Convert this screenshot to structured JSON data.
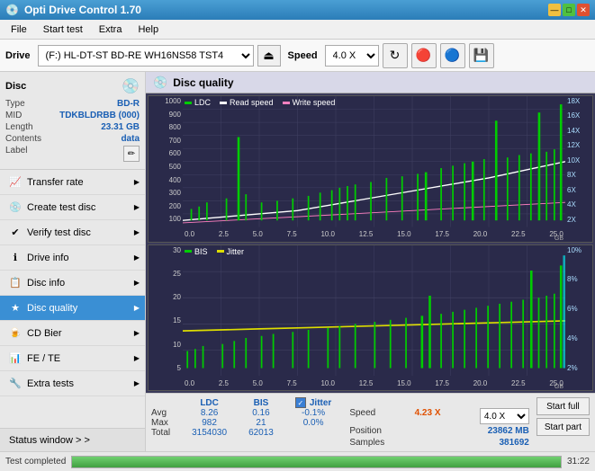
{
  "titlebar": {
    "title": "Opti Drive Control 1.70",
    "icon": "💿",
    "min_btn": "—",
    "max_btn": "□",
    "close_btn": "✕"
  },
  "menubar": {
    "items": [
      {
        "label": "File"
      },
      {
        "label": "Start test"
      },
      {
        "label": "Extra"
      },
      {
        "label": "Help"
      }
    ]
  },
  "toolbar": {
    "drive_label": "Drive",
    "drive_value": "(F:)  HL-DT-ST BD-RE  WH16NS58 TST4",
    "speed_label": "Speed",
    "speed_value": "4.0 X",
    "eject_icon": "⏏",
    "refresh_icon": "↻",
    "icon1": "🔴",
    "icon2": "🔵",
    "save_icon": "💾"
  },
  "disc": {
    "section_label": "Disc",
    "type_label": "Type",
    "type_value": "BD-R",
    "mid_label": "MID",
    "mid_value": "TDKBLDRBB (000)",
    "length_label": "Length",
    "length_value": "23.31 GB",
    "contents_label": "Contents",
    "contents_value": "data",
    "label_label": "Label",
    "label_btn_icon": "✏"
  },
  "sidebar_nav": [
    {
      "id": "transfer-rate",
      "label": "Transfer rate",
      "icon": "📈"
    },
    {
      "id": "create-test-disc",
      "label": "Create test disc",
      "icon": "💿"
    },
    {
      "id": "verify-test-disc",
      "label": "Verify test disc",
      "icon": "✔"
    },
    {
      "id": "drive-info",
      "label": "Drive info",
      "icon": "ℹ"
    },
    {
      "id": "disc-info",
      "label": "Disc info",
      "icon": "📋"
    },
    {
      "id": "disc-quality",
      "label": "Disc quality",
      "icon": "★",
      "active": true
    },
    {
      "id": "cd-bier",
      "label": "CD Bier",
      "icon": "🍺"
    },
    {
      "id": "fe-te",
      "label": "FE / TE",
      "icon": "📊"
    },
    {
      "id": "extra-tests",
      "label": "Extra tests",
      "icon": "🔧"
    }
  ],
  "status_window": {
    "label": "Status window > >"
  },
  "disc_quality": {
    "title": "Disc quality",
    "legend": {
      "ldc_label": "LDC",
      "ldc_color": "#00cc00",
      "read_speed_label": "Read speed",
      "read_speed_color": "#ffffff",
      "write_speed_label": "Write speed",
      "write_speed_color": "#ff69b4"
    },
    "legend2": {
      "bis_label": "BIS",
      "bis_color": "#00cc00",
      "jitter_label": "Jitter",
      "jitter_color": "#dddd00"
    },
    "chart1_y_left": [
      "1000",
      "900",
      "800",
      "700",
      "600",
      "500",
      "400",
      "300",
      "200",
      "100"
    ],
    "chart1_y_right": [
      "18X",
      "16X",
      "14X",
      "12X",
      "10X",
      "8X",
      "6X",
      "4X",
      "2X"
    ],
    "chart2_y_left": [
      "30",
      "25",
      "20",
      "15",
      "10",
      "5"
    ],
    "chart2_y_right": [
      "10%",
      "8%",
      "6%",
      "4%",
      "2%"
    ],
    "x_labels": [
      "0.0",
      "2.5",
      "5.0",
      "7.5",
      "10.0",
      "12.5",
      "15.0",
      "17.5",
      "20.0",
      "22.5",
      "25.0"
    ],
    "gb_label": "GB"
  },
  "stats": {
    "col_headers": [
      "LDC",
      "BIS",
      "",
      "Jitter",
      "Speed",
      "4.23 X",
      "4.0 X"
    ],
    "avg_label": "Avg",
    "avg_ldc": "8.26",
    "avg_bis": "0.16",
    "avg_jitter": "-0.1%",
    "max_label": "Max",
    "max_ldc": "982",
    "max_bis": "21",
    "max_jitter": "0.0%",
    "total_label": "Total",
    "total_ldc": "3154030",
    "total_bis": "62013",
    "position_label": "Position",
    "position_value": "23862 MB",
    "samples_label": "Samples",
    "samples_value": "381692",
    "speed_label": "Speed",
    "speed_display": "4.23 X",
    "speed_select": "4.0 X",
    "start_full_label": "Start full",
    "start_part_label": "Start part",
    "jitter_checkbox": "✓",
    "jitter_label": "Jitter"
  },
  "statusbar": {
    "status_text": "Test completed",
    "progress": 100,
    "time_text": "31:22"
  }
}
